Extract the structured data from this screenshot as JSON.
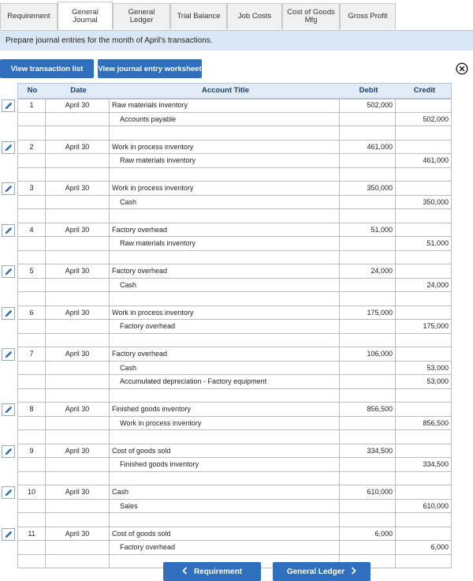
{
  "tabs": [
    {
      "label": "Requirement"
    },
    {
      "label": "General\nJournal"
    },
    {
      "label": "General\nLedger"
    },
    {
      "label": "Trial Balance"
    },
    {
      "label": "Job Costs"
    },
    {
      "label": "Cost of Goods\nMfg"
    },
    {
      "label": "Gross Profit"
    }
  ],
  "instruction": "Prepare journal entries for the month of April's transactions.",
  "buttons": {
    "view_transactions": "View transaction list",
    "view_worksheet": "View journal entry worksheet"
  },
  "table": {
    "headers": {
      "no": "No",
      "date": "Date",
      "account": "Account Title",
      "debit": "Debit",
      "credit": "Credit"
    },
    "entries": [
      {
        "no": "1",
        "date": "April 30",
        "lines": [
          {
            "account": "Raw materials inventory",
            "debit": "502,000",
            "credit": ""
          },
          {
            "account": "Accounts payable",
            "debit": "",
            "credit": "502,000"
          }
        ]
      },
      {
        "no": "2",
        "date": "April 30",
        "lines": [
          {
            "account": "Work in process inventory",
            "debit": "461,000",
            "credit": ""
          },
          {
            "account": "Raw materials inventory",
            "debit": "",
            "credit": "461,000"
          }
        ]
      },
      {
        "no": "3",
        "date": "April 30",
        "lines": [
          {
            "account": "Work in process inventory",
            "debit": "350,000",
            "credit": ""
          },
          {
            "account": "Cash",
            "debit": "",
            "credit": "350,000"
          }
        ]
      },
      {
        "no": "4",
        "date": "April 30",
        "lines": [
          {
            "account": "Factory overhead",
            "debit": "51,000",
            "credit": ""
          },
          {
            "account": "Raw materials inventory",
            "debit": "",
            "credit": "51,000"
          }
        ]
      },
      {
        "no": "5",
        "date": "April 30",
        "lines": [
          {
            "account": "Factory overhead",
            "debit": "24,000",
            "credit": ""
          },
          {
            "account": "Cash",
            "debit": "",
            "credit": "24,000"
          }
        ]
      },
      {
        "no": "6",
        "date": "April 30",
        "lines": [
          {
            "account": "Work in process inventory",
            "debit": "175,000",
            "credit": ""
          },
          {
            "account": "Factory overhead",
            "debit": "",
            "credit": "175,000"
          }
        ]
      },
      {
        "no": "7",
        "date": "April 30",
        "lines": [
          {
            "account": "Factory overhead",
            "debit": "106,000",
            "credit": ""
          },
          {
            "account": "Cash",
            "debit": "",
            "credit": "53,000"
          },
          {
            "account": "Accumulated depreciation - Factory equipment",
            "debit": "",
            "credit": "53,000"
          }
        ]
      },
      {
        "no": "8",
        "date": "April 30",
        "lines": [
          {
            "account": "Finished goods inventory",
            "debit": "856,500",
            "credit": ""
          },
          {
            "account": "Work in process inventory",
            "debit": "",
            "credit": "856,500"
          }
        ]
      },
      {
        "no": "9",
        "date": "April 30",
        "lines": [
          {
            "account": "Cost of goods sold",
            "debit": "334,500",
            "credit": ""
          },
          {
            "account": "Finished goods inventory",
            "debit": "",
            "credit": "334,500"
          }
        ]
      },
      {
        "no": "10",
        "date": "April 30",
        "lines": [
          {
            "account": "Cash",
            "debit": "610,000",
            "credit": ""
          },
          {
            "account": "Sales",
            "debit": "",
            "credit": "610,000"
          }
        ]
      },
      {
        "no": "11",
        "date": "April 30",
        "lines": [
          {
            "account": "Cost of goods sold",
            "debit": "6,000",
            "credit": ""
          },
          {
            "account": "Factory overhead",
            "debit": "",
            "credit": "6,000"
          }
        ]
      }
    ]
  },
  "nav": {
    "prev": "Requirement",
    "next": "General Ledger"
  },
  "colors": {
    "accent": "#2f6fbd",
    "header_bg": "#e1ecf7",
    "instruction_bg": "#d9e7f4"
  },
  "icons": {
    "edit": "pencil-icon",
    "close": "close-circle-icon",
    "prev": "chevron-left-icon",
    "next": "chevron-right-icon"
  }
}
